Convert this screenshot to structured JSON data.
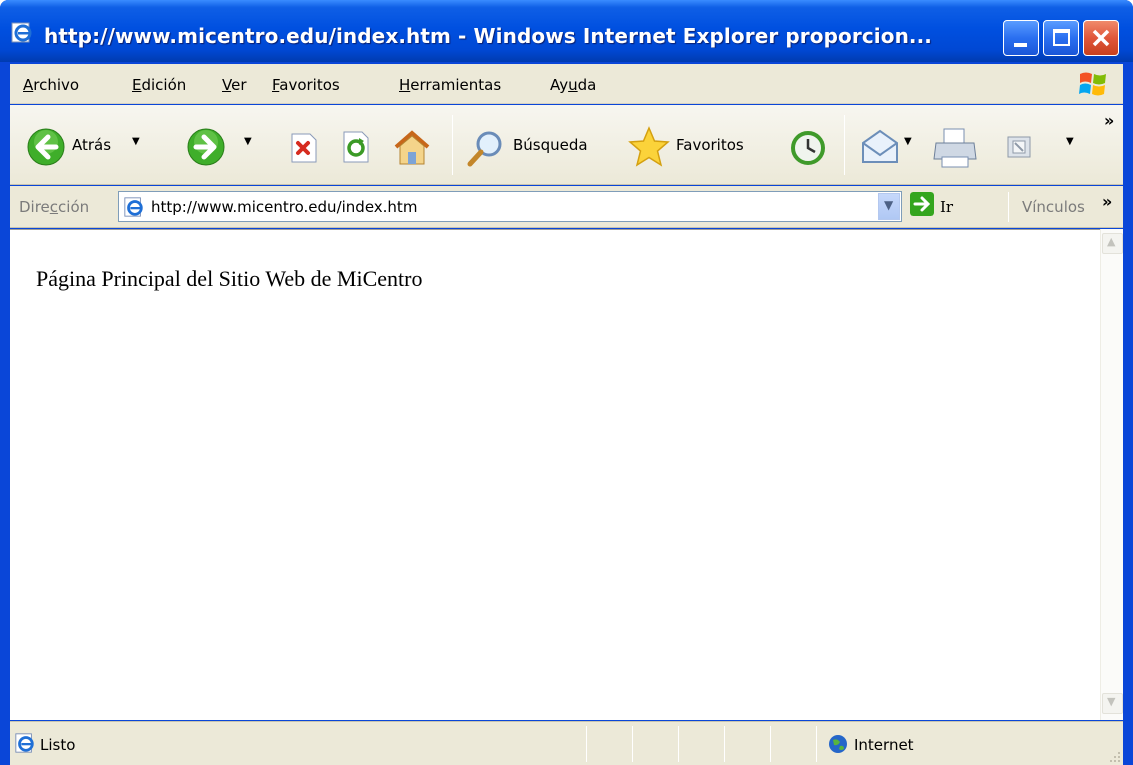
{
  "window": {
    "title": "http://www.micentro.edu/index.htm - Windows Internet Explorer proporcion...",
    "buttons": {
      "minimize": "minimize-icon",
      "maximize": "maximize-icon",
      "close": "close-icon"
    }
  },
  "menubar": {
    "items": [
      {
        "label": "Archivo",
        "accel": "A",
        "rest": "rchivo"
      },
      {
        "label": "Edición",
        "accel": "E",
        "rest": "dición"
      },
      {
        "label": "Ver",
        "accel": "V",
        "rest": "er"
      },
      {
        "label": "Favoritos",
        "accel": "F",
        "rest": "avoritos"
      },
      {
        "label": "Herramientas",
        "accel": "H",
        "rest": "erramientas"
      },
      {
        "label": "Ayuda",
        "pre": "Ay",
        "accel": "u",
        "rest": "da"
      }
    ]
  },
  "toolbar": {
    "back_label": "Atrás",
    "search_label": "Búsqueda",
    "favorites_label": "Favoritos",
    "overflow": "»"
  },
  "address": {
    "label_pre": "Dire",
    "label_accel": "c",
    "label_rest": "ción",
    "url": "http://www.micentro.edu/index.htm",
    "go_label": "Ir",
    "links_label": "Vínculos",
    "overflow": "»"
  },
  "content": {
    "text": "Página Principal del Sitio Web de MiCentro"
  },
  "status": {
    "text": "Listo",
    "zone": "Internet"
  },
  "colors": {
    "titlebar": "#0050e0",
    "chrome": "#ece9d8",
    "close_button": "#e0563a"
  }
}
